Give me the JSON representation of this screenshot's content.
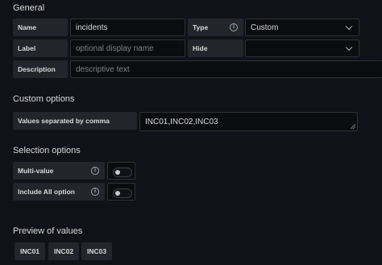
{
  "general": {
    "title": "General",
    "name_label": "Name",
    "name_value": "incidents",
    "type_label": "Type",
    "type_value": "Custom",
    "label_label": "Label",
    "label_placeholder": "optional display name",
    "hide_label": "Hide",
    "hide_value": "",
    "description_label": "Description",
    "description_placeholder": "descriptive text"
  },
  "custom_options": {
    "title": "Custom options",
    "values_label": "Values separated by comma",
    "values_value": "INC01,INC02,INC03"
  },
  "selection_options": {
    "title": "Selection options",
    "multi_value_label": "Multi-value",
    "multi_value_enabled": false,
    "include_all_label": "Include All option",
    "include_all_enabled": false
  },
  "preview": {
    "title": "Preview of values",
    "values": [
      "INC01",
      "INC02",
      "INC03"
    ]
  },
  "icons": {
    "info": "info-circle-icon",
    "dropdown": "chevron-down-icon"
  }
}
